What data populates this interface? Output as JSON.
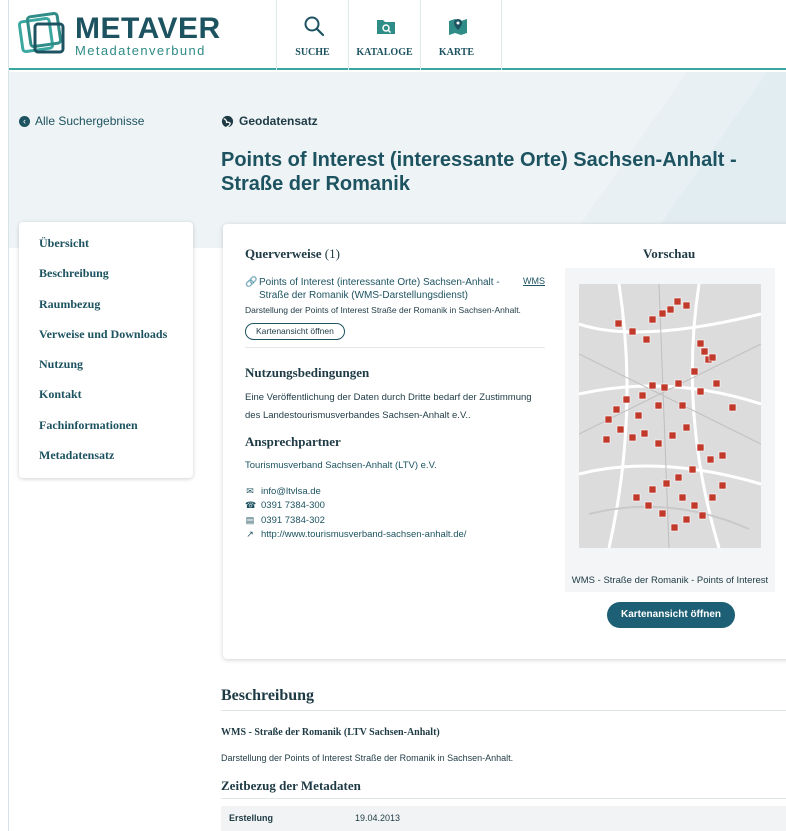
{
  "brand": {
    "name": "METAVER",
    "subtitle": "Metadatenverbund"
  },
  "nav": [
    {
      "label": "SUCHE",
      "icon": "search-icon"
    },
    {
      "label": "KATALOGE",
      "icon": "catalog-icon"
    },
    {
      "label": "KARTE",
      "icon": "map-icon"
    }
  ],
  "back_link": "Alle Suchergebnisse",
  "dataset_type": "Geodatensatz",
  "title": "Points of Interest (interessante Orte) Sachsen-Anhalt - Straße der Romanik",
  "sidebar": [
    "Übersicht",
    "Beschreibung",
    "Raumbezug",
    "Verweise und Downloads",
    "Nutzung",
    "Kontakt",
    "Fachinformationen",
    "Metadatensatz"
  ],
  "querverweise": {
    "title": "Querverweise",
    "count": "(1)",
    "item": {
      "link": "Points of Interest (interessante Orte) Sachsen-Anhalt - Straße der Romanik (WMS-Darstellungsdienst)",
      "badge": "WMS",
      "description": "Darstellung der Points of Interest Straße der Romanik in Sachsen-Anhalt.",
      "button": "Kartenansicht öffnen"
    }
  },
  "nutzung": {
    "title": "Nutzungsbedingungen",
    "text": "Eine Veröffentlichung der Daten durch Dritte bedarf der Zustimmung des Landestourismusverbandes Sachsen-Anhalt e.V.."
  },
  "ansprechpartner": {
    "title": "Ansprechpartner",
    "org": "Tourismusverband Sachsen-Anhalt (LTV) e.V.",
    "contacts": [
      {
        "icon": "mail-icon",
        "glyph": "✉",
        "value": "info@ltvlsa.de"
      },
      {
        "icon": "phone-icon",
        "glyph": "☎",
        "value": "0391 7384-300"
      },
      {
        "icon": "fax-icon",
        "glyph": "▤",
        "value": "0391 7384-302"
      },
      {
        "icon": "external-link-icon",
        "glyph": "↗",
        "value": "http://www.tourismusverband-sachsen-anhalt.de/"
      }
    ]
  },
  "vorschau": {
    "title": "Vorschau",
    "caption": "WMS - Straße der Romanik - Points of Interest",
    "button": "Kartenansicht öffnen"
  },
  "beschreibung": {
    "title": "Beschreibung",
    "dataset_title": "WMS - Straße der Romanik (LTV Sachsen-Anhalt)",
    "dataset_desc": "Darstellung der Points of Interest Straße der Romanik in Sachsen-Anhalt."
  },
  "zeitbezug": {
    "title": "Zeitbezug der Metadaten",
    "rows": [
      {
        "key": "Erstellung",
        "value": "19.04.2013"
      }
    ]
  },
  "colors": {
    "primary": "#1d5360",
    "accent": "#3aa8a0",
    "button": "#1d5f74",
    "marker": "#c0392b"
  }
}
